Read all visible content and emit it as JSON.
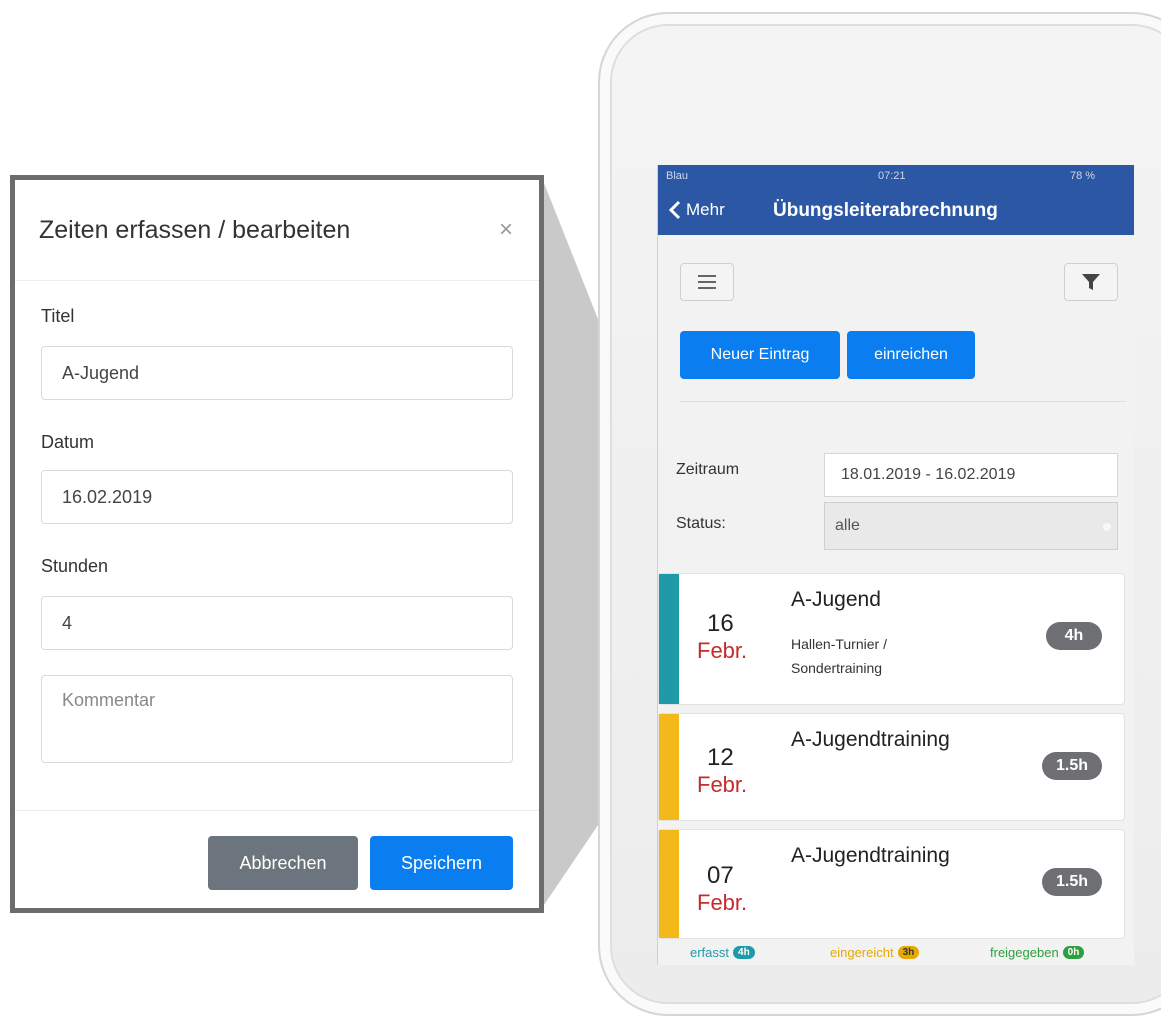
{
  "modal": {
    "title": "Zeiten erfassen / bearbeiten",
    "close": "×",
    "fields": [
      {
        "label": "Titel",
        "value": "A-Jugend"
      },
      {
        "label": "Datum",
        "value": "16.02.2019"
      },
      {
        "label": "Stunden",
        "value": "4"
      }
    ],
    "comment_placeholder": "Kommentar",
    "cancel_label": "Abbrechen",
    "save_label": "Speichern",
    "colors": {
      "cancel": "#6c757d",
      "save": "#0a7ef0",
      "border": "#6c6c6c"
    }
  },
  "phone": {
    "status": {
      "carrier": "Blau",
      "time": "07:21",
      "battery": "78 %"
    },
    "nav": {
      "back_label": "Mehr",
      "title": "Übungsleiterabrechnung",
      "color": "#2b57a4"
    },
    "actions": {
      "new_entry": "Neuer Eintrag",
      "submit": "einreichen"
    },
    "filters": {
      "period_label": "Zeitraum",
      "period_value": "18.01.2019 - 16.02.2019",
      "status_label": "Status:",
      "status_value": "alle"
    },
    "entries": [
      {
        "day": "16",
        "month": "Febr.",
        "title": "A-Jugend",
        "description": "Hallen-Turnier / Sondertraining",
        "hours": "4h",
        "status_color": "#1f9aa8"
      },
      {
        "day": "12",
        "month": "Febr.",
        "title": "A-Jugendtraining",
        "description": "",
        "hours": "1.5h",
        "status_color": "#f3b91a"
      },
      {
        "day": "07",
        "month": "Febr.",
        "title": "A-Jugendtraining",
        "description": "",
        "hours": "1.5h",
        "status_color": "#f3b91a"
      }
    ],
    "legend": [
      {
        "label": "erfasst",
        "count": "4h",
        "color": "#1f9aa8"
      },
      {
        "label": "eingereicht",
        "count": "3h",
        "color": "#e7a800"
      },
      {
        "label": "freigegeben",
        "count": "0h",
        "color": "#2e9e3e"
      }
    ]
  }
}
